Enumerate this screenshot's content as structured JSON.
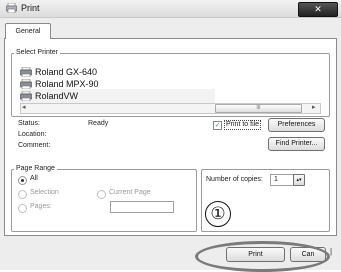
{
  "window": {
    "title": "Print",
    "close_label": "✕"
  },
  "tabs": [
    {
      "label": "General"
    }
  ],
  "select_printer": {
    "group_label": "Select Printer",
    "printers": [
      "Roland GX-640",
      "Roland MPX-90",
      "RolandVW"
    ],
    "scrollbar_grip": "III"
  },
  "status": {
    "status_label": "Status:",
    "status_value": "Ready",
    "location_label": "Location:",
    "comment_label": "Comment:"
  },
  "print_to_file_label": "Print to file",
  "preferences_label": "Preferences",
  "find_printer_label": "Find Printer...",
  "page_range": {
    "group_label": "Page Range",
    "all_label": "All",
    "selection_label": "Selection",
    "current_page_label": "Current Page",
    "pages_label": "Pages:"
  },
  "copies": {
    "label": "Number of copies:",
    "value": "1"
  },
  "annotation_number": "①",
  "buttons": {
    "print_label": "Print",
    "cancel_label": "Can"
  },
  "colors": {
    "window_bg": "#ededed",
    "panel_bg": "#ffffff",
    "close_btn": "#333333",
    "annotation_oval": "#7a7a7a"
  }
}
